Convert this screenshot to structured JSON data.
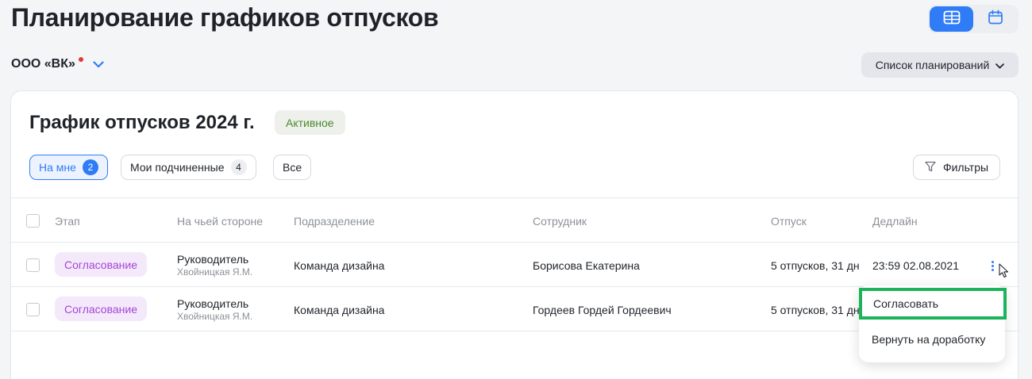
{
  "header": {
    "title": "Планирование графиков отпусков"
  },
  "view_toggle": {
    "table_icon": "table-icon",
    "calendar_icon": "calendar-icon",
    "active": "table"
  },
  "org": {
    "name": "ООО «ВК»",
    "chevron_icon": "chevron-down-icon"
  },
  "plans_button": {
    "label": "Список планирований"
  },
  "schedule": {
    "title": "График отпусков 2024 г.",
    "status": "Активное"
  },
  "chips": [
    {
      "label": "На мне",
      "count": "2"
    },
    {
      "label": "Мои подчиненные",
      "count": "4"
    },
    {
      "label": "Все"
    }
  ],
  "filters": {
    "label": "Фильтры",
    "icon": "filter-icon"
  },
  "table": {
    "columns": [
      "Этап",
      "На чьей стороне",
      "Подразделение",
      "Сотрудник",
      "Отпуск",
      "Дедлайн"
    ],
    "rows": [
      {
        "stage": "Согласование",
        "side": "Руководитель",
        "side_person": "Хвойницкая Я.М.",
        "department": "Команда дизайна",
        "employee": "Борисова Екатерина",
        "vacation": "5 отпусков, 31 дн",
        "deadline": "23:59 02.08.2021"
      },
      {
        "stage": "Согласование",
        "side": "Руководитель",
        "side_person": "Хвойницкая Я.М.",
        "department": "Команда дизайна",
        "employee": "Гордеев Гордей Гордеевич",
        "vacation": "5 отпусков, 31 дн",
        "deadline": ""
      }
    ]
  },
  "context_menu": {
    "items": [
      "Согласовать",
      "Вернуть на доработку"
    ]
  },
  "colors": {
    "accent": "#2f7cf6",
    "stage_badge_text": "#a545d6",
    "stage_badge_bg": "#f4e9fb",
    "status_text": "#4b8a2a",
    "highlight": "#1db35a"
  }
}
